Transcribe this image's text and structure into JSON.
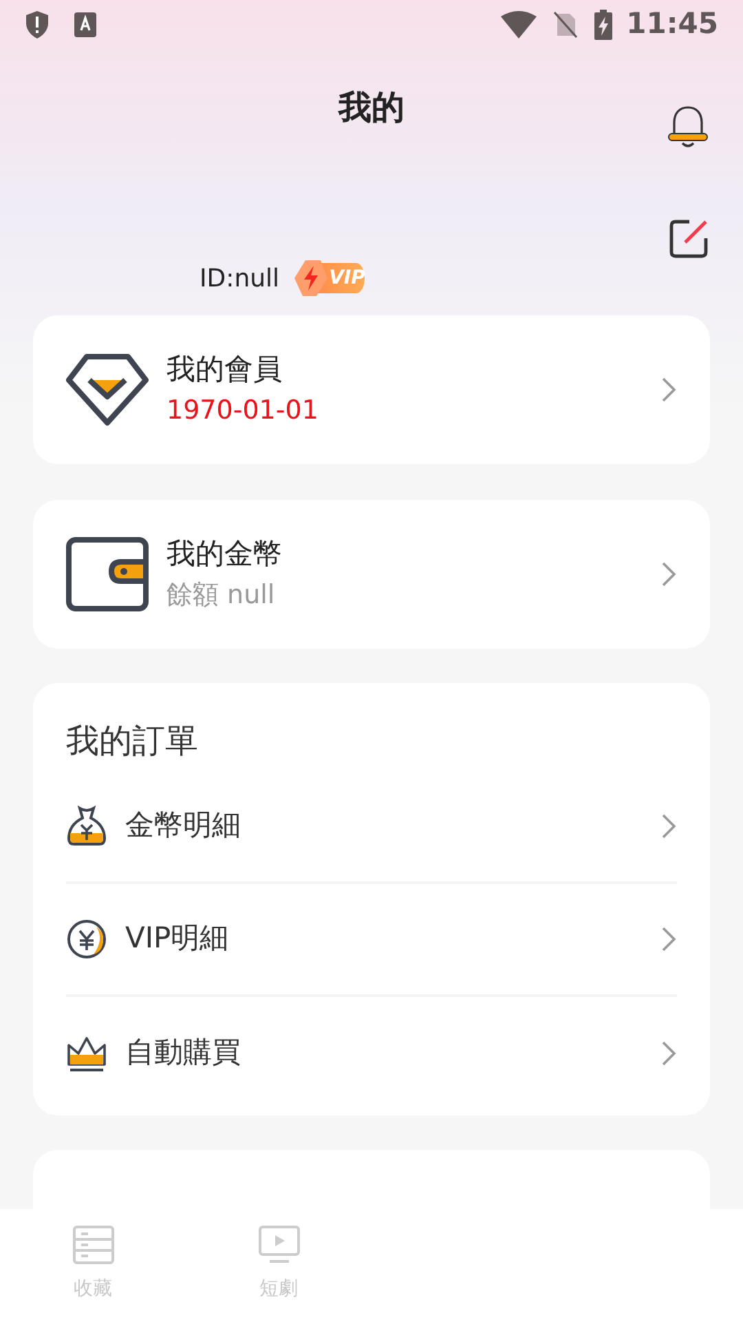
{
  "status_bar": {
    "time": "11:45"
  },
  "header": {
    "title": "我的"
  },
  "profile": {
    "id_text": "ID:null",
    "badge": "VIP"
  },
  "cards": [
    {
      "kind": "member",
      "title": "我的會員",
      "subtitle": "1970-01-01"
    },
    {
      "kind": "coins",
      "title": "我的金幣",
      "subtitle": "餘額 null"
    }
  ],
  "orders": {
    "title": "我的訂單",
    "items": [
      {
        "kind": "bag",
        "label": "金幣明細"
      },
      {
        "kind": "coin",
        "label": "VIP明細"
      },
      {
        "kind": "crown",
        "label": "自動購買"
      }
    ]
  },
  "bottom_nav": [
    {
      "kind": "list",
      "label": "收藏",
      "selected": false
    },
    {
      "kind": "play",
      "label": "短劇",
      "selected": false
    }
  ]
}
